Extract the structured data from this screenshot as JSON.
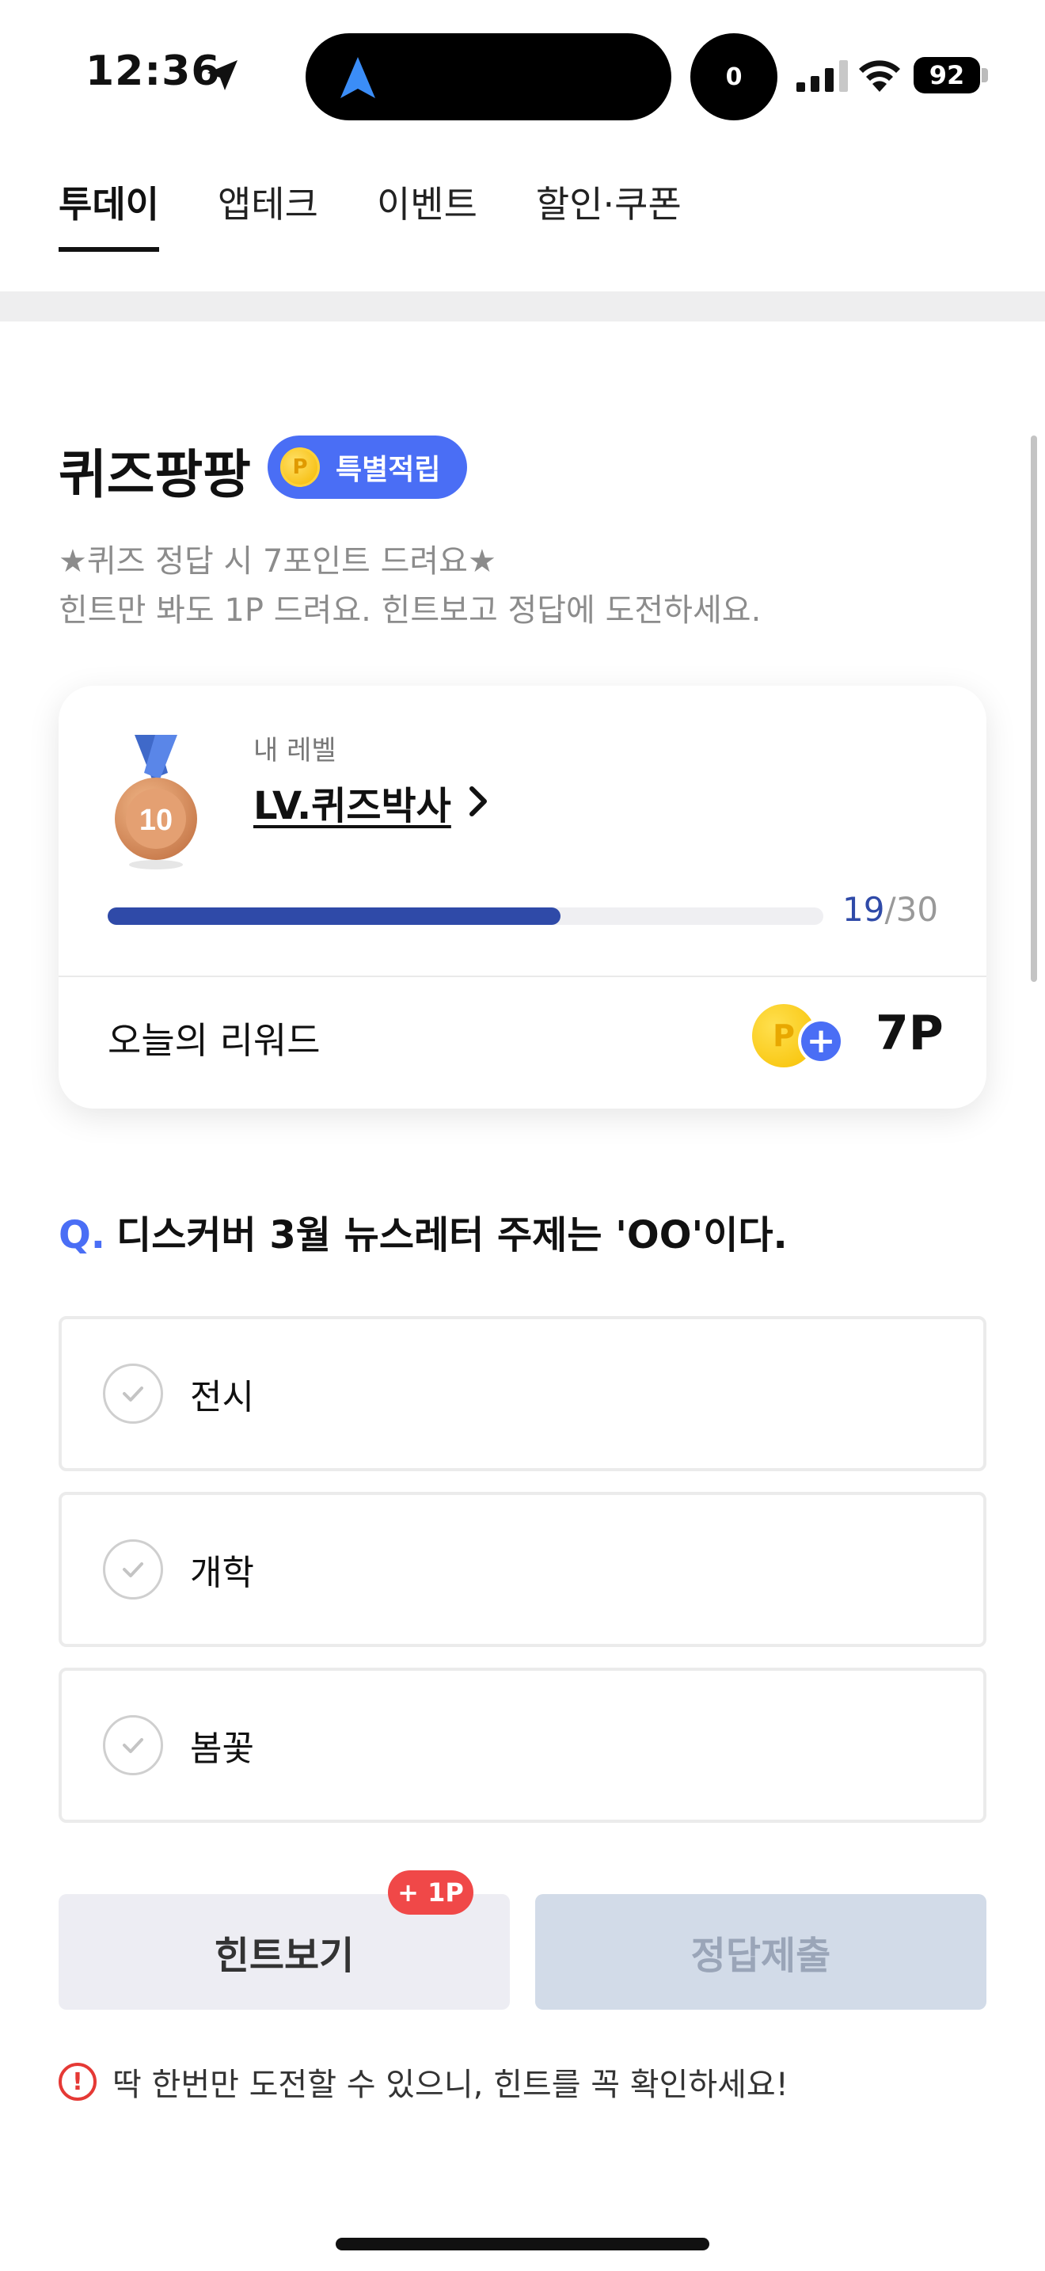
{
  "status_bar": {
    "time": "12:36",
    "island_badge": "0",
    "battery": "92"
  },
  "tabs": [
    {
      "label": "투데이",
      "active": true
    },
    {
      "label": "앱테크",
      "active": false
    },
    {
      "label": "이벤트",
      "active": false
    },
    {
      "label": "할인·쿠폰",
      "active": false
    }
  ],
  "quiz": {
    "title": "퀴즈팡팡",
    "badge_label": "특별적립",
    "coin_symbol": "P",
    "desc_line1": "★퀴즈 정답 시 7포인트 드려요★",
    "desc_line2": "힌트만 봐도 1P 드려요. 힌트보고 정답에 도전하세요."
  },
  "level_card": {
    "caption": "내 레벨",
    "level_name": "LV.퀴즈박사",
    "medal_number": "10",
    "progress_current": "19",
    "progress_separator": "/",
    "progress_total": "30",
    "progress_fraction": 0.633,
    "reward_label": "오늘의 리워드",
    "reward_coin_symbol": "P",
    "reward_value": "7P"
  },
  "question": {
    "prefix": "Q.",
    "text": "디스커버 3월 뉴스레터 주제는 'OO'이다."
  },
  "options": [
    {
      "label": "전시"
    },
    {
      "label": "개학"
    },
    {
      "label": "봄꽃"
    }
  ],
  "actions": {
    "hint_label": "힌트보기",
    "hint_badge": "+ 1P",
    "submit_label": "정답제출"
  },
  "warning": {
    "icon": "!",
    "text": "딱 한번만 도전할 수 있으니, 힌트를 꼭 확인하세요!"
  },
  "colors": {
    "accent": "#4a6ef5",
    "progress": "#2f4aa8",
    "badge_red": "#f04848",
    "coin_gold": "#f7c000"
  }
}
